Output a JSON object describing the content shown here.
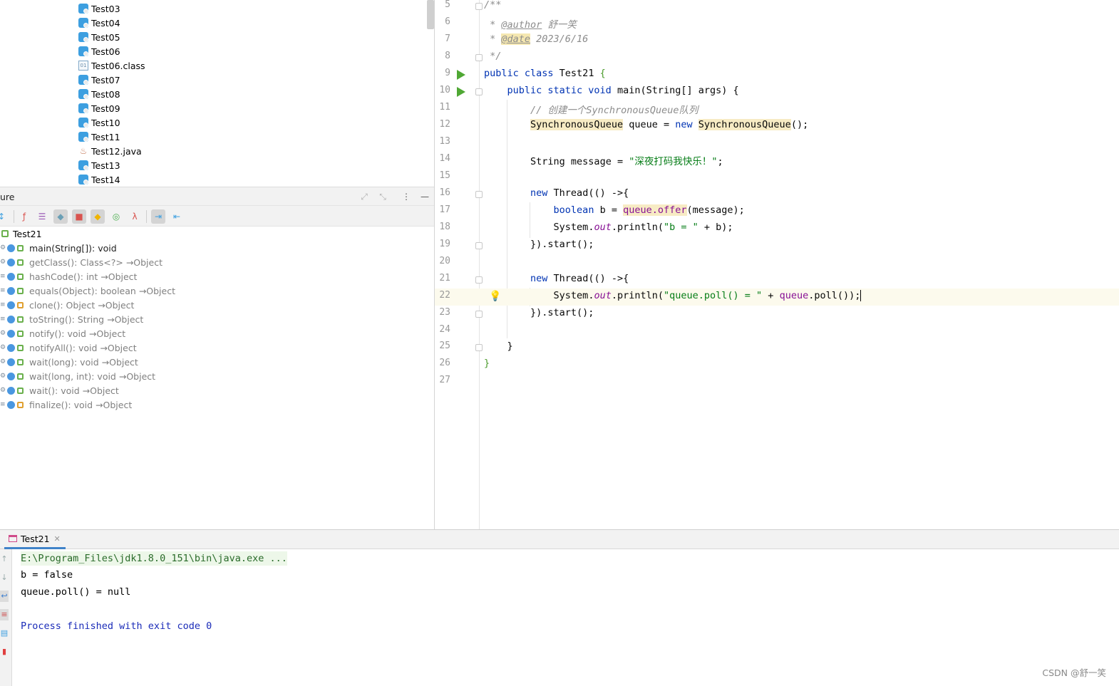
{
  "project_tree": {
    "items": [
      {
        "label": "Test03",
        "kind": "class"
      },
      {
        "label": "Test04",
        "kind": "class"
      },
      {
        "label": "Test05",
        "kind": "class"
      },
      {
        "label": "Test06",
        "kind": "class"
      },
      {
        "label": "Test06.class",
        "kind": "binary-file"
      },
      {
        "label": "Test07",
        "kind": "class"
      },
      {
        "label": "Test08",
        "kind": "class"
      },
      {
        "label": "Test09",
        "kind": "class"
      },
      {
        "label": "Test10",
        "kind": "class"
      },
      {
        "label": "Test11",
        "kind": "class"
      },
      {
        "label": "Test12.java",
        "kind": "java-file"
      },
      {
        "label": "Test13",
        "kind": "class"
      },
      {
        "label": "Test14",
        "kind": "class"
      }
    ]
  },
  "structure": {
    "title": "ure",
    "root": "Test21",
    "methods": [
      {
        "name": "main(String[]): void",
        "inherited_from": ""
      },
      {
        "name": "getClass(): Class<?>",
        "inherited_from": "→Object"
      },
      {
        "name": "hashCode(): int",
        "inherited_from": "→Object"
      },
      {
        "name": "equals(Object): boolean",
        "inherited_from": "→Object"
      },
      {
        "name": "clone(): Object",
        "inherited_from": "→Object"
      },
      {
        "name": "toString(): String",
        "inherited_from": "→Object"
      },
      {
        "name": "notify(): void",
        "inherited_from": "→Object"
      },
      {
        "name": "notifyAll(): void",
        "inherited_from": "→Object"
      },
      {
        "name": "wait(long): void",
        "inherited_from": "→Object"
      },
      {
        "name": "wait(long, int): void",
        "inherited_from": "→Object"
      },
      {
        "name": "wait(): void",
        "inherited_from": "→Object"
      },
      {
        "name": "finalize(): void",
        "inherited_from": "→Object"
      }
    ]
  },
  "editor": {
    "line_numbers": [
      "5",
      "6",
      "7",
      "8",
      "9",
      "10",
      "11",
      "12",
      "13",
      "14",
      "15",
      "16",
      "17",
      "18",
      "19",
      "20",
      "21",
      "22",
      "23",
      "24",
      "25",
      "26",
      "27"
    ],
    "code": {
      "l5": "/**",
      "l6_star": " * ",
      "l6_tag": "@author",
      "l6_text": " 舒一笑",
      "l7_star": " * ",
      "l7_tag": "@date",
      "l7_text": " 2023/6/16",
      "l8": " */",
      "l9_kw": "public class",
      "l9_name": " Test21 ",
      "l9_brace": "{",
      "l10_kw": "public static void",
      "l10_rest": " main(String[] args) {",
      "l11": "// 创建一个SynchronousQueue队列",
      "l12_type": "SynchronousQueue",
      "l12_mid": " queue = ",
      "l12_new": "new",
      "l12_type2": "SynchronousQueue",
      "l12_end": "();",
      "l14_pre": "String message = ",
      "l14_str": "\"深夜打码我快乐！\"",
      "l14_end": ";",
      "l16_new": "new",
      "l16_rest": " Thread(() ->{",
      "l17_kw": "boolean",
      "l17_mid": " b = ",
      "l17_q": "queue.offer",
      "l17_end": "(message);",
      "l18_pre": "System.",
      "l18_out": "out",
      "l18_mid": ".println(",
      "l18_str": "\"b = \"",
      "l18_end": " + b);",
      "l19": "}).start();",
      "l21_new": "new",
      "l21_rest": " Thread(() ->{",
      "l22_pre": "System.",
      "l22_out": "out",
      "l22_mid": ".println(",
      "l22_str": "\"queue.poll() = \"",
      "l22_plus": " + ",
      "l22_q": "queue",
      "l22_end": ".poll());",
      "l23": "}).start();",
      "l25": "}",
      "l26": "}"
    }
  },
  "run": {
    "tab_label": "Test21",
    "console": {
      "command": "E:\\Program_Files\\jdk1.8.0_151\\bin\\java.exe ...",
      "out1": "b = false",
      "out2": "queue.poll() = null",
      "exit": "Process finished with exit code 0"
    }
  },
  "watermark": "CSDN @舒一笑",
  "colors": {
    "keyword": "#0033b3",
    "string": "#067d17",
    "comment": "#8c8c8c",
    "field": "#871094",
    "run_gutter": "#4fa834",
    "exit_text": "#1a2bb8"
  }
}
